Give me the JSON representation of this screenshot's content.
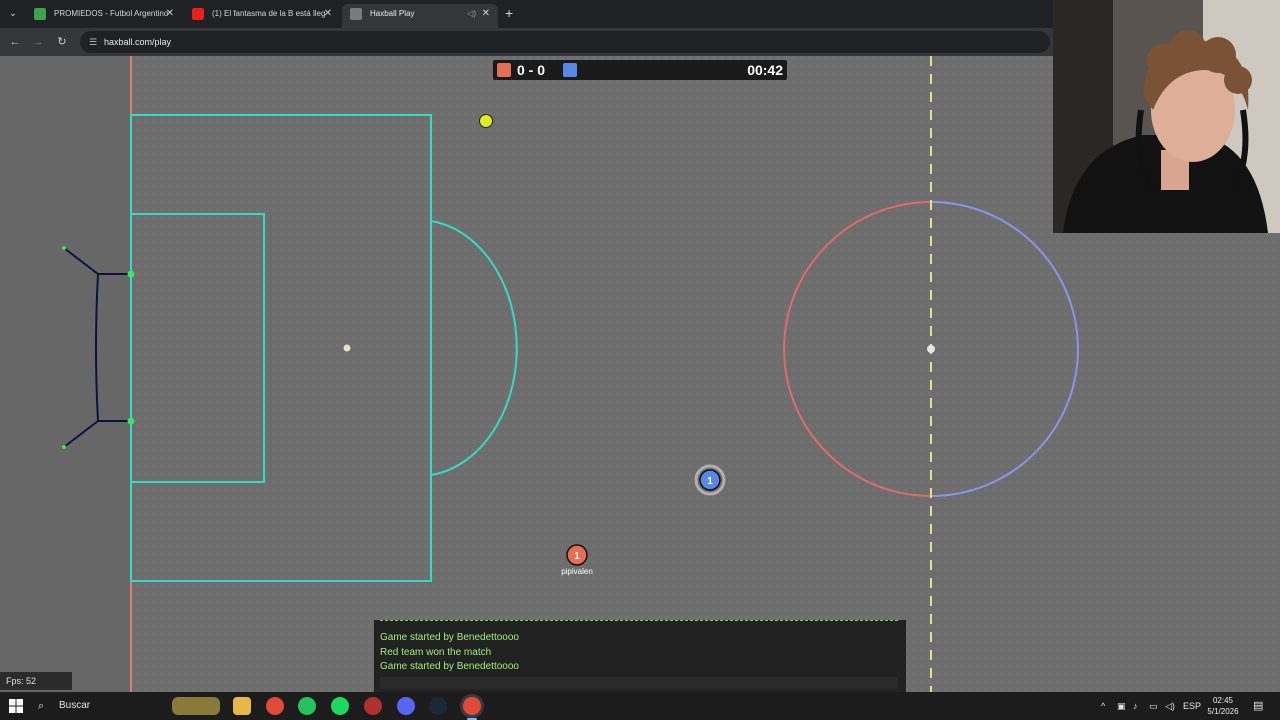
{
  "browser": {
    "tabs": [
      {
        "title": "PROMIEDOS - Futbol Argentino",
        "favicon": "promiedos-icon",
        "color": "#3ca24e"
      },
      {
        "title": "(1) El fantasma de la B está lleg",
        "favicon": "youtube-icon",
        "color": "#e62117"
      },
      {
        "title": "Haxball Play",
        "favicon": "haxball-icon",
        "color": "#7a7a7a",
        "active": true
      }
    ],
    "new_tab_label": "+",
    "url": "haxball.com/play"
  },
  "game": {
    "score": "0 - 0",
    "time": "00:42",
    "red_color": "#e56e56",
    "blue_color": "#5689e5",
    "players": [
      {
        "team": "blue",
        "number": "1",
        "name": ""
      },
      {
        "team": "red",
        "number": "1",
        "name": "pipivalen"
      }
    ],
    "fps_label": "Fps: 52"
  },
  "chat": {
    "messages": [
      "Game started by Benedettoooo",
      "Red team won the match",
      "Game started by Benedettoooo"
    ]
  },
  "taskbar": {
    "search_label": "Buscar",
    "language": "ESP",
    "time": "02:45",
    "date": "5/1/2026"
  }
}
